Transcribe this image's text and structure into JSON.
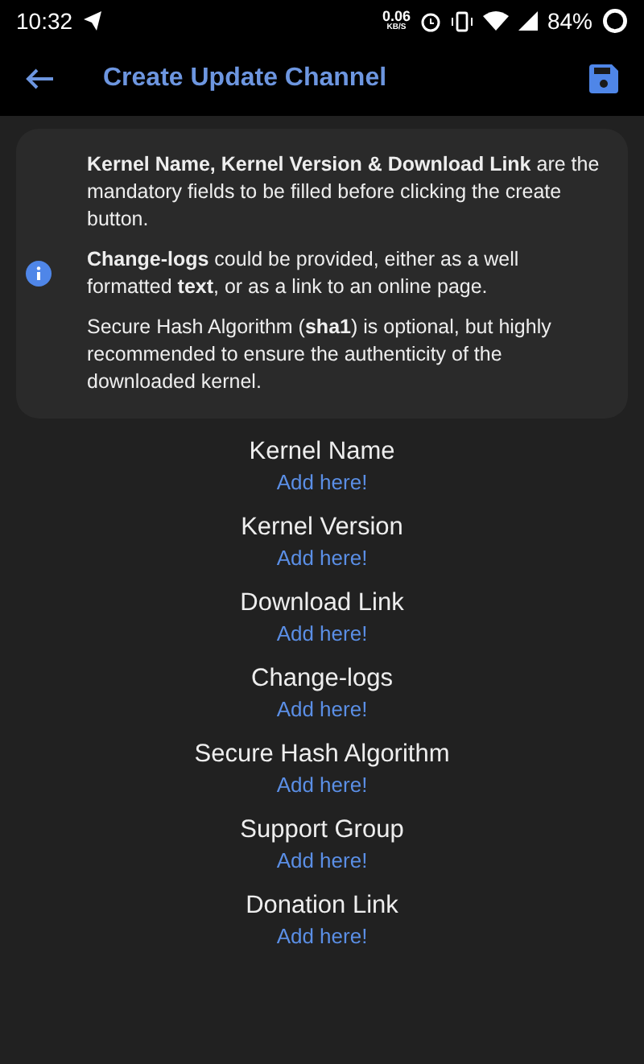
{
  "status_bar": {
    "time": "10:32",
    "net_speed": "0.06",
    "net_unit": "KB/S",
    "battery": "84%"
  },
  "app_bar": {
    "title": "Create Update Channel"
  },
  "info_card": {
    "paragraphs": [
      "**Kernel Name, Kernel Version & Download Link** are the mandatory fields to be filled before clicking the create button.",
      "**Change-logs** could be provided, either as a well formatted **text**, or as a link to an online page.",
      "Secure Hash Algorithm (**sha1**) is optional, but highly recommended to ensure the authenticity of the downloaded kernel."
    ]
  },
  "fields": [
    {
      "label": "Kernel Name",
      "placeholder": "Add here!"
    },
    {
      "label": "Kernel Version",
      "placeholder": "Add here!"
    },
    {
      "label": "Download Link",
      "placeholder": "Add here!"
    },
    {
      "label": "Change-logs",
      "placeholder": "Add here!"
    },
    {
      "label": "Secure Hash Algorithm",
      "placeholder": "Add here!"
    },
    {
      "label": "Support Group",
      "placeholder": "Add here!"
    },
    {
      "label": "Donation Link",
      "placeholder": "Add here!"
    }
  ]
}
